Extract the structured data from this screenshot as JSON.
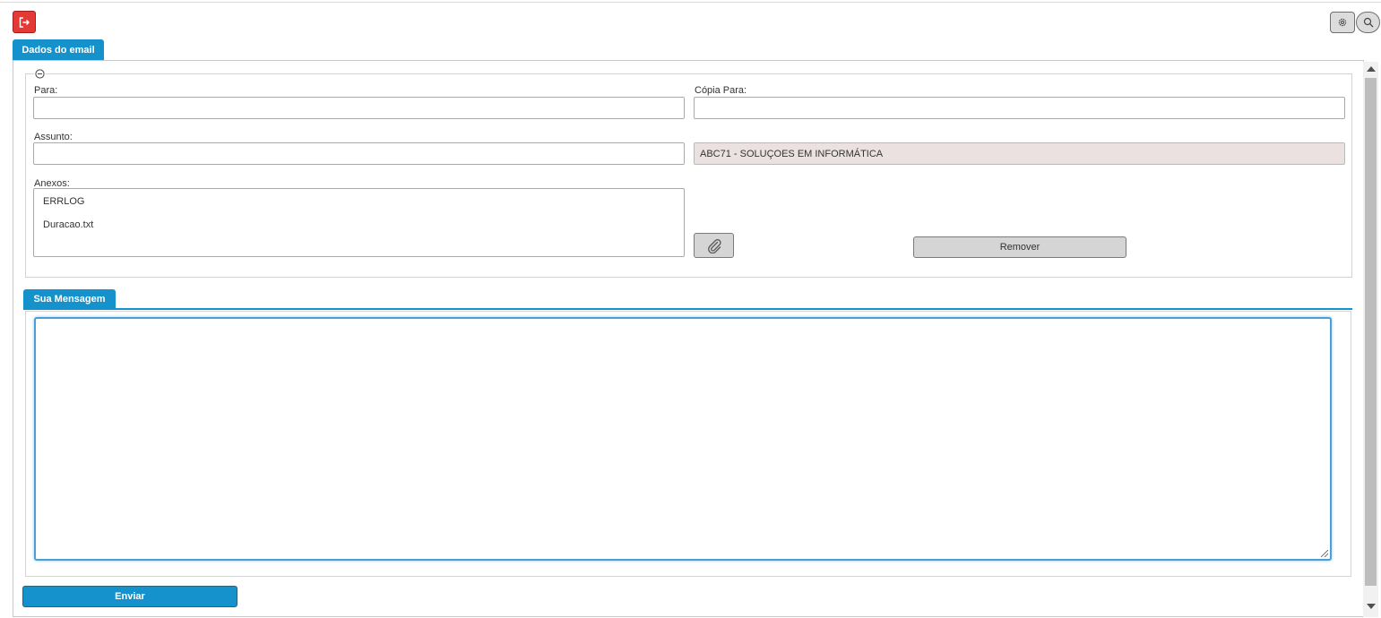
{
  "toolbar": {
    "exit_icon": "exit-icon",
    "settings_icon": "gear-icon",
    "search_icon": "search-icon"
  },
  "tabs": {
    "email_data": "Dados do email",
    "message": "Sua Mensagem"
  },
  "form": {
    "to_label": "Para:",
    "to_value": "",
    "cc_label": "Cópia Para:",
    "cc_value": "",
    "subject_label": "Assunto:",
    "subject_value": "",
    "sender_value": "ABC71 - SOLUÇOES EM INFORMÁTICA",
    "attachments_label": "Anexos:",
    "attachments": [
      "ERRLOG",
      "Duracao.txt"
    ],
    "remove_label": "Remover",
    "attach_icon": "paperclip-icon"
  },
  "message": {
    "body": ""
  },
  "actions": {
    "send_label": "Enviar"
  },
  "colors": {
    "accent": "#1591cc",
    "exit_button": "#e53935",
    "readonly_field": "#ebe1e1"
  }
}
